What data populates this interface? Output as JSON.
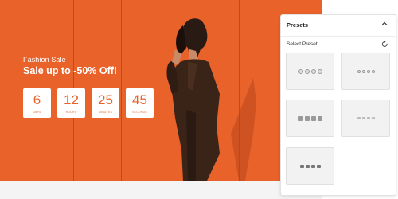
{
  "banner": {
    "eyebrow": "Fashion Sale",
    "headline": "Sale up to -50% Off!",
    "background_color": "#e8622a",
    "countdown": [
      {
        "value": "6",
        "unit": "Days"
      },
      {
        "value": "12",
        "unit": "Hours"
      },
      {
        "value": "25",
        "unit": "Minutes"
      },
      {
        "value": "45",
        "unit": "Seconds"
      }
    ]
  },
  "panel": {
    "title": "Presets",
    "collapse_icon": "chevron-up-icon",
    "select_label": "Select Preset",
    "reset_icon": "reset-icon",
    "presets": [
      {
        "style": "circles"
      },
      {
        "style": "dots"
      },
      {
        "style": "squares"
      },
      {
        "style": "dashes"
      },
      {
        "style": "text"
      }
    ]
  }
}
